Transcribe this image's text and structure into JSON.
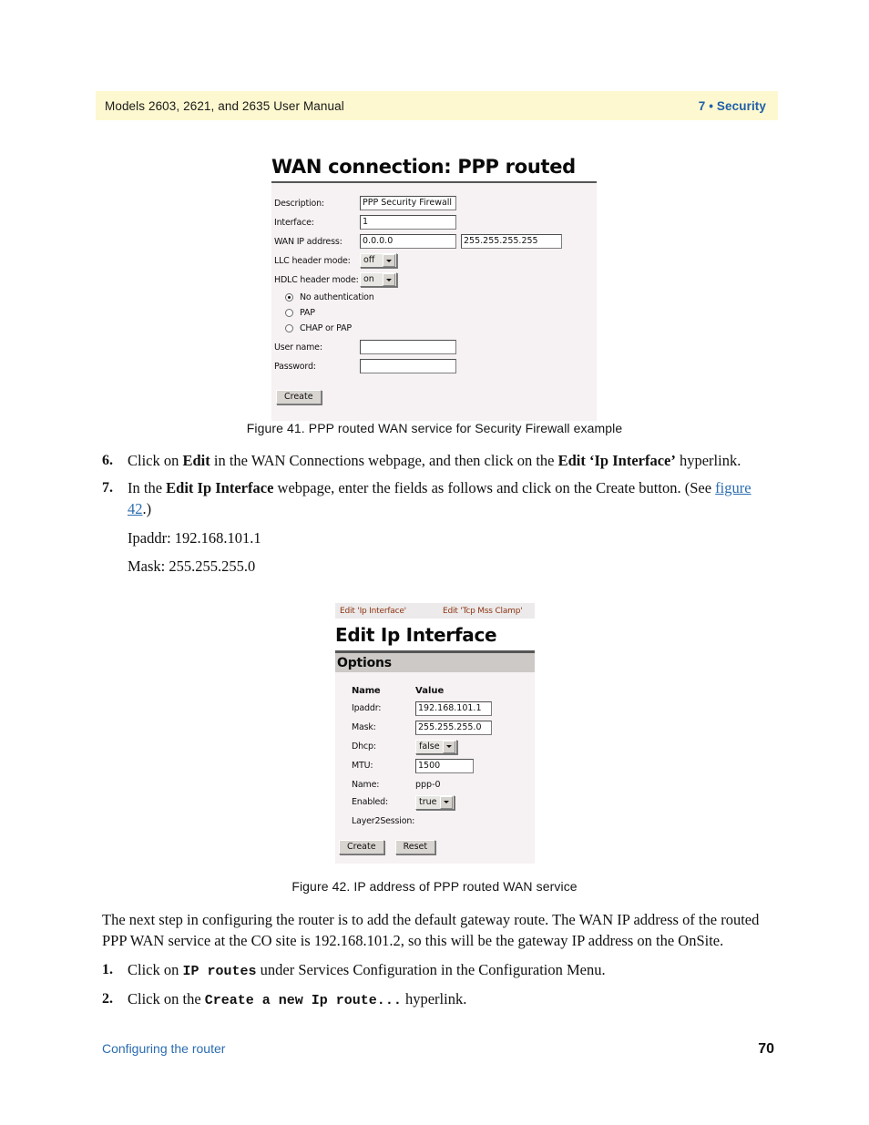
{
  "header": {
    "manual_title": "Models 2603, 2621, and 2635 User Manual",
    "chapter": "7 • Security",
    "band_color": "#fdf8cf",
    "chapter_color": "#1f5fa9"
  },
  "figure41": {
    "title": "WAN connection: PPP routed",
    "fields": {
      "description_label": "Description:",
      "description_value": "PPP Security Firewall",
      "interface_label": "Interface:",
      "interface_value": "1",
      "wan_ip_label": "WAN IP address:",
      "wan_ip_value": "0.0.0.0",
      "wan_mask_value": "255.255.255.255",
      "llc_label": "LLC header mode:",
      "llc_value": "off",
      "hdlc_label": "HDLC header mode:",
      "hdlc_value": "on",
      "username_label": "User name:",
      "username_value": "",
      "password_label": "Password:",
      "password_value": ""
    },
    "auth_options": [
      {
        "label": "No authentication",
        "selected": true
      },
      {
        "label": "PAP",
        "selected": false
      },
      {
        "label": "CHAP or PAP",
        "selected": false
      }
    ],
    "create_button": "Create",
    "caption": "Figure 41. PPP routed WAN service for Security Firewall example"
  },
  "steps_upper": {
    "item6": {
      "number": "6.",
      "text_a": "Click on ",
      "bold_a": "Edit",
      "text_b": " in the WAN Connections webpage, and then click on the ",
      "bold_b": "Edit ‘Ip Interface’",
      "text_c": " hyperlink."
    },
    "item7": {
      "number": "7.",
      "text_a": "In the ",
      "bold_a": "Edit Ip Interface",
      "text_b": " webpage, enter the fields as follows and click on the Create button. (See ",
      "link": "figure 42",
      "text_c": ".)"
    },
    "ipaddr_line": "Ipaddr: 192.168.101.1",
    "mask_line": "Mask: 255.255.255.0"
  },
  "figure42": {
    "tabs": [
      {
        "label": "Edit 'Ip Interface'"
      },
      {
        "label": "Edit 'Tcp Mss Clamp'"
      }
    ],
    "tab_color": "#8e3514",
    "title": "Edit Ip Interface",
    "section_header": "Options",
    "column_headers": {
      "name": "Name",
      "value": "Value"
    },
    "rows": [
      {
        "label": "Ipaddr:",
        "value": "192.168.101.1",
        "type": "text"
      },
      {
        "label": "Mask:",
        "value": "255.255.255.0",
        "type": "text"
      },
      {
        "label": "Dhcp:",
        "value": "false",
        "type": "select"
      },
      {
        "label": "MTU:",
        "value": "1500",
        "type": "text"
      },
      {
        "label": "Name:",
        "value": "ppp-0",
        "type": "static"
      },
      {
        "label": "Enabled:",
        "value": "true",
        "type": "select"
      },
      {
        "label": "Layer2Session:",
        "value": "",
        "type": "static"
      }
    ],
    "create_button": "Create",
    "reset_button": "Reset",
    "caption": "Figure 42. IP address of PPP routed WAN service"
  },
  "paragraph": "The next step in configuring the router is to add the default gateway route. The WAN IP address of the routed PPP WAN service at the CO site is 192.168.101.2, so this will be the gateway IP address on the OnSite.",
  "steps_lower": {
    "item1": {
      "number": "1.",
      "text_a": "Click on ",
      "mono_a": "IP routes",
      "text_b": " under Services Configuration in the Configuration Menu."
    },
    "item2": {
      "number": "2.",
      "text_a": "Click on the ",
      "mono_a": "Create a new Ip route...",
      "text_b": " hyperlink."
    }
  },
  "footer": {
    "section": "Configuring the router",
    "page_number": "70",
    "link_color": "#2b6cb0"
  }
}
